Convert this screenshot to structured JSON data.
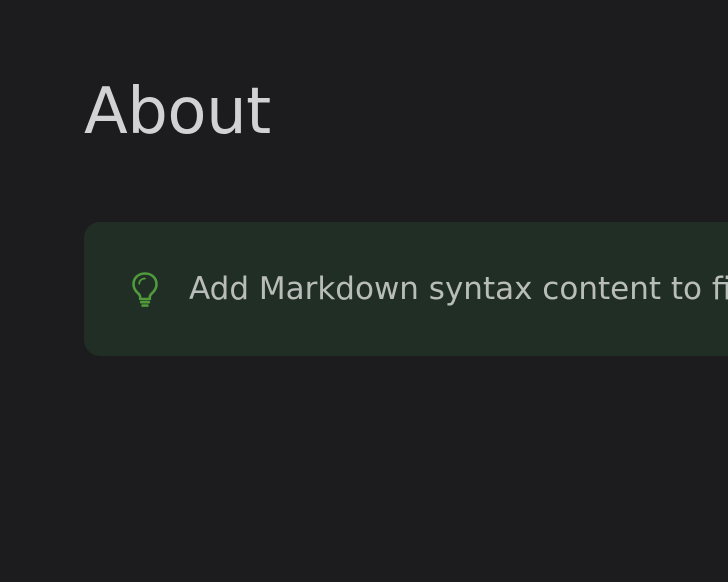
{
  "page": {
    "title": "About"
  },
  "tip": {
    "icon": "lightbulb-icon",
    "text": "Add Markdown syntax content to file",
    "accent_color": "#4f9a3a",
    "background_color": "#212e25"
  },
  "colors": {
    "background": "#1c1c1e",
    "title": "#d2d2d4",
    "tip_text": "#b9bdb9"
  }
}
